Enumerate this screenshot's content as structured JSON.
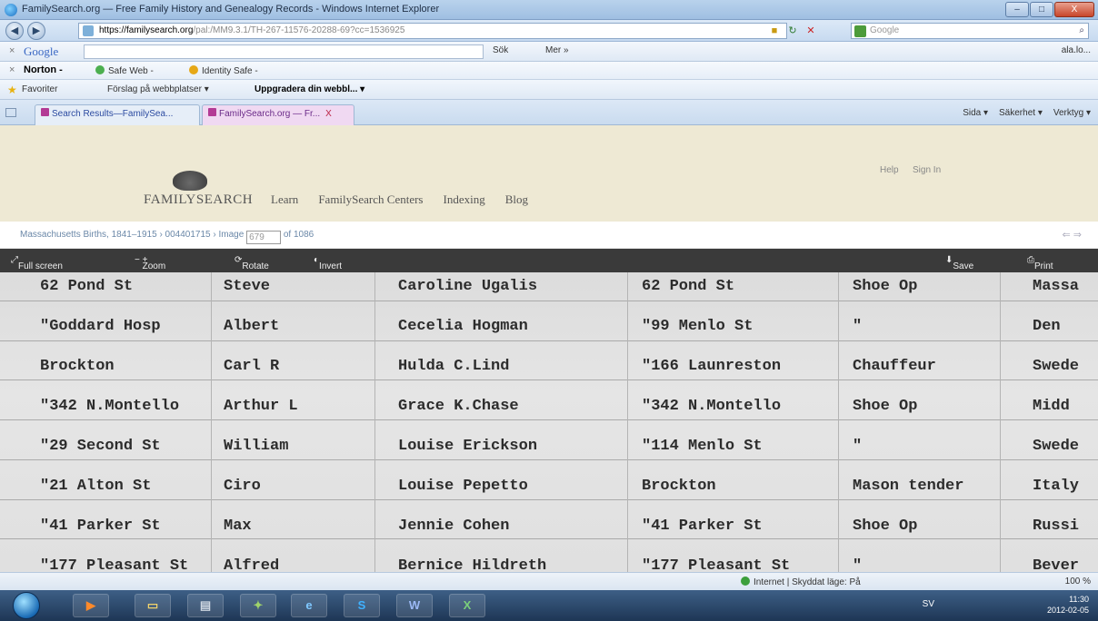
{
  "window": {
    "title": "FamilySearch.org — Free Family History and Genealogy Records - Windows Internet Explorer",
    "controls": [
      "–",
      "□",
      "X"
    ]
  },
  "address": {
    "url_host": "https://familysearch.org",
    "url_path": "/pal:/MM9.3.1/TH-267-11576-20288-69?cc=1536925",
    "search_placeholder": "Google"
  },
  "google_toolbar": {
    "label": "Google",
    "search": "Sök",
    "more": "Mer »",
    "right": "ala.lo..."
  },
  "norton_toolbar": {
    "label": "Norton -",
    "safe_web": "Safe Web -",
    "identity_safe": "Identity Safe -"
  },
  "favorites_bar": {
    "label": "Favoriter",
    "suggested": "Förslag på webbplatser ▾",
    "upgrade": "Uppgradera din webbl... ▾"
  },
  "tabs": {
    "items": [
      {
        "label": "Search Results—FamilySea..."
      },
      {
        "label": "FamilySearch.org — Fr...",
        "close": "X"
      }
    ],
    "commands": [
      "Sida ▾",
      "Säkerhet ▾",
      "Verktyg ▾"
    ]
  },
  "site": {
    "brand": "FAMILYSEARCH",
    "nav": [
      "Learn",
      "FamilySearch Centers",
      "Indexing",
      "Blog"
    ],
    "help": "Help",
    "sign_in": "Sign In"
  },
  "breadcrumb": {
    "collection": "Massachusetts Births, 1841–1915",
    "film": "004401715",
    "image_label": "Image",
    "image_value": "679",
    "of_total": "of 1086",
    "arrows": "⇐ ⇒"
  },
  "viewer": {
    "full_screen": "Full screen",
    "zoom": "Zoom",
    "rotate": "Rotate",
    "invert": "Invert",
    "save": "Save",
    "print": "Print"
  },
  "document": {
    "rows": [
      [
        "62 Pond St",
        "Steve",
        "Caroline Ugalis",
        "62 Pond St",
        "Shoe Op",
        "Massa"
      ],
      [
        "\"Goddard Hosp",
        "Albert",
        "Cecelia Hogman",
        "\"99 Menlo St",
        "\"",
        "Den"
      ],
      [
        "Brockton",
        "Carl R",
        "Hulda C.Lind",
        "\"166 Launreston",
        "Chauffeur",
        "Swede"
      ],
      [
        "\"342 N.Montello",
        "Arthur L",
        "Grace K.Chase",
        "\"342 N.Montello",
        "Shoe Op",
        "Midd"
      ],
      [
        "\"29 Second St",
        "William",
        "Louise Erickson",
        "\"114 Menlo St",
        "\"",
        "Swede"
      ],
      [
        "\"21 Alton St",
        "Ciro",
        "Louise Pepetto",
        "Brockton",
        "Mason tender",
        "Italy"
      ],
      [
        "\"41 Parker St",
        "Max",
        "Jennie Cohen",
        "\"41 Parker St",
        "Shoe Op",
        "Russi"
      ],
      [
        "\"177 Pleasant St",
        "Alfred",
        "Bernice Hildreth",
        "\"177 Pleasant St",
        "\"",
        "Bever"
      ]
    ]
  },
  "statusbar": {
    "zone": "Internet | Skyddat läge: På",
    "zoom": "100 %"
  },
  "taskbar": {
    "time": "11:30",
    "date": "2012-02-05",
    "lang": "SV"
  }
}
